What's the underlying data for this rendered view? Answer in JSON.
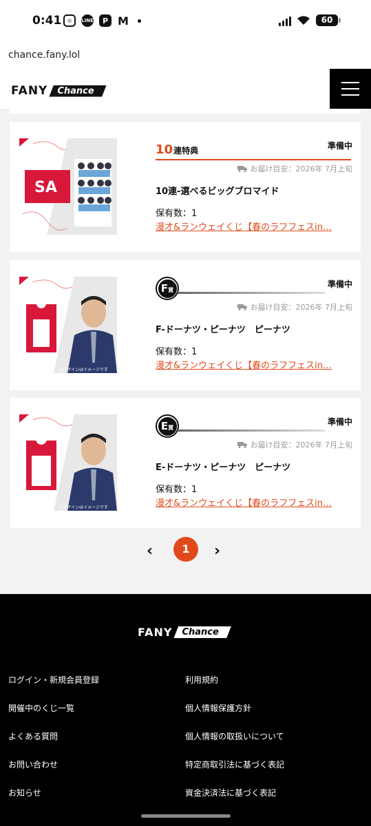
{
  "status_bar": {
    "time": "0:41",
    "battery": "60",
    "icons": [
      "instagram-icon",
      "line-icon",
      "paypay-icon",
      "gmail-icon",
      "dot-icon",
      "signal-icon",
      "wifi-icon",
      "battery-icon"
    ]
  },
  "browser": {
    "url": "chance.fany.lol"
  },
  "header": {
    "logo_fany": "FANY",
    "logo_chance": "Chance",
    "menu_icon": "hamburger-menu-icon"
  },
  "items": [
    {
      "badge_type": "ten",
      "badge_num": "10",
      "badge_text": "連特典",
      "status": "準備中",
      "delivery": "お届け目安：2026年 7月上旬",
      "name": "10連-選べるビッグブロマイド",
      "quantity": "保有数：1",
      "lottery": "漫才&ランウェイくじ【春のラフフェスin…"
    },
    {
      "badge_type": "prize",
      "badge_letter": "F",
      "badge_suffix": "賞",
      "status": "準備中",
      "delivery": "お届け目安：2026年 7月上旬",
      "name": "F-ドーナツ・ピーナツ　ピーナツ",
      "quantity": "保有数：1",
      "lottery": "漫才&ランウェイくじ【春のラフフェスin…"
    },
    {
      "badge_type": "prize",
      "badge_letter": "E",
      "badge_suffix": "賞",
      "status": "準備中",
      "delivery": "お届け目安：2026年 7月上旬",
      "name": "E-ドーナツ・ピーナツ　ピーナツ",
      "quantity": "保有数：1",
      "lottery": "漫才&ランウェイくじ【春のラフフェスin…"
    }
  ],
  "pagination": {
    "prev": "‹",
    "current": "1",
    "next": "›"
  },
  "footer": {
    "logo_fany": "FANY",
    "logo_chance": "Chance",
    "left_links": [
      "ログイン・新規会員登録",
      "開催中のくじ一覧",
      "よくある質問",
      "お問い合わせ",
      "お知らせ"
    ],
    "right_links": [
      "利用規約",
      "個人情報保護方針",
      "個人情報の取扱いについて",
      "特定商取引法に基づく表記",
      "資金決済法に基づく表記"
    ]
  },
  "colors": {
    "accent": "#e04a1a",
    "footer_bg": "#000000",
    "page_bg": "#f2f2f2"
  }
}
